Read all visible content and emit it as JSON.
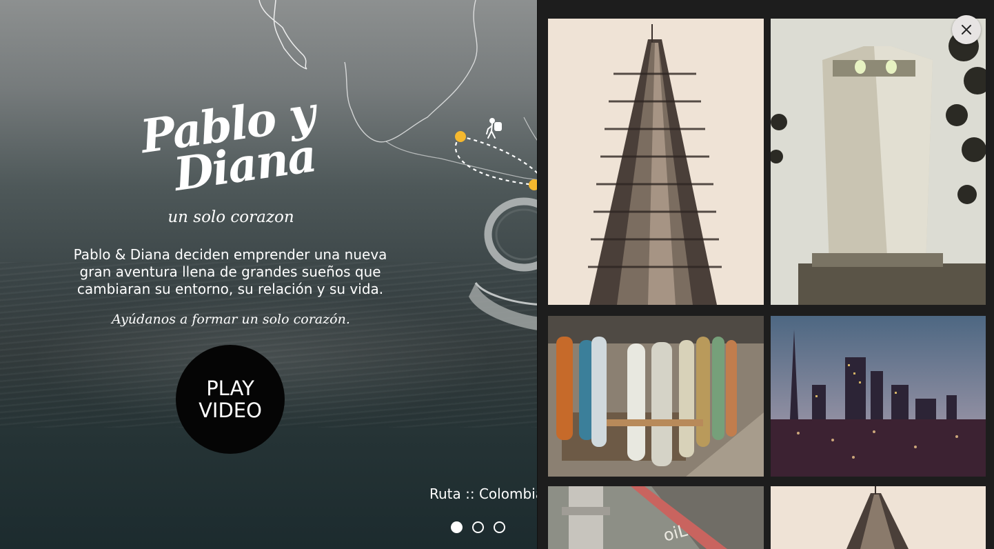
{
  "hero": {
    "brand_line1": "Pablo y",
    "brand_line2": "Diana",
    "tagline": "un solo corazon",
    "description": "Pablo & Diana deciden emprender una nueva gran aventura llena de grandes sueños que cambiaran su entorno, su relación y su vida.",
    "cta_line": "Ayúdanos a formar un solo corazón.",
    "play_button": {
      "line1": "PLAY",
      "line2": "VIDEO"
    },
    "route_label": "Ruta :: Colombia",
    "slider": {
      "count": 3,
      "active_index": 0
    },
    "map_icons": [
      "hiker-icon",
      "route-point-icon"
    ],
    "accent_color": "#f5b82e"
  },
  "gallery": {
    "close_icon": "close-icon",
    "photos": [
      "flatiron-building-photo",
      "coit-tower-photo",
      "skateboards-planter-photo",
      "city-skyline-night-photo",
      "fire-hydrant-photo",
      "flatiron-building-photo"
    ]
  }
}
